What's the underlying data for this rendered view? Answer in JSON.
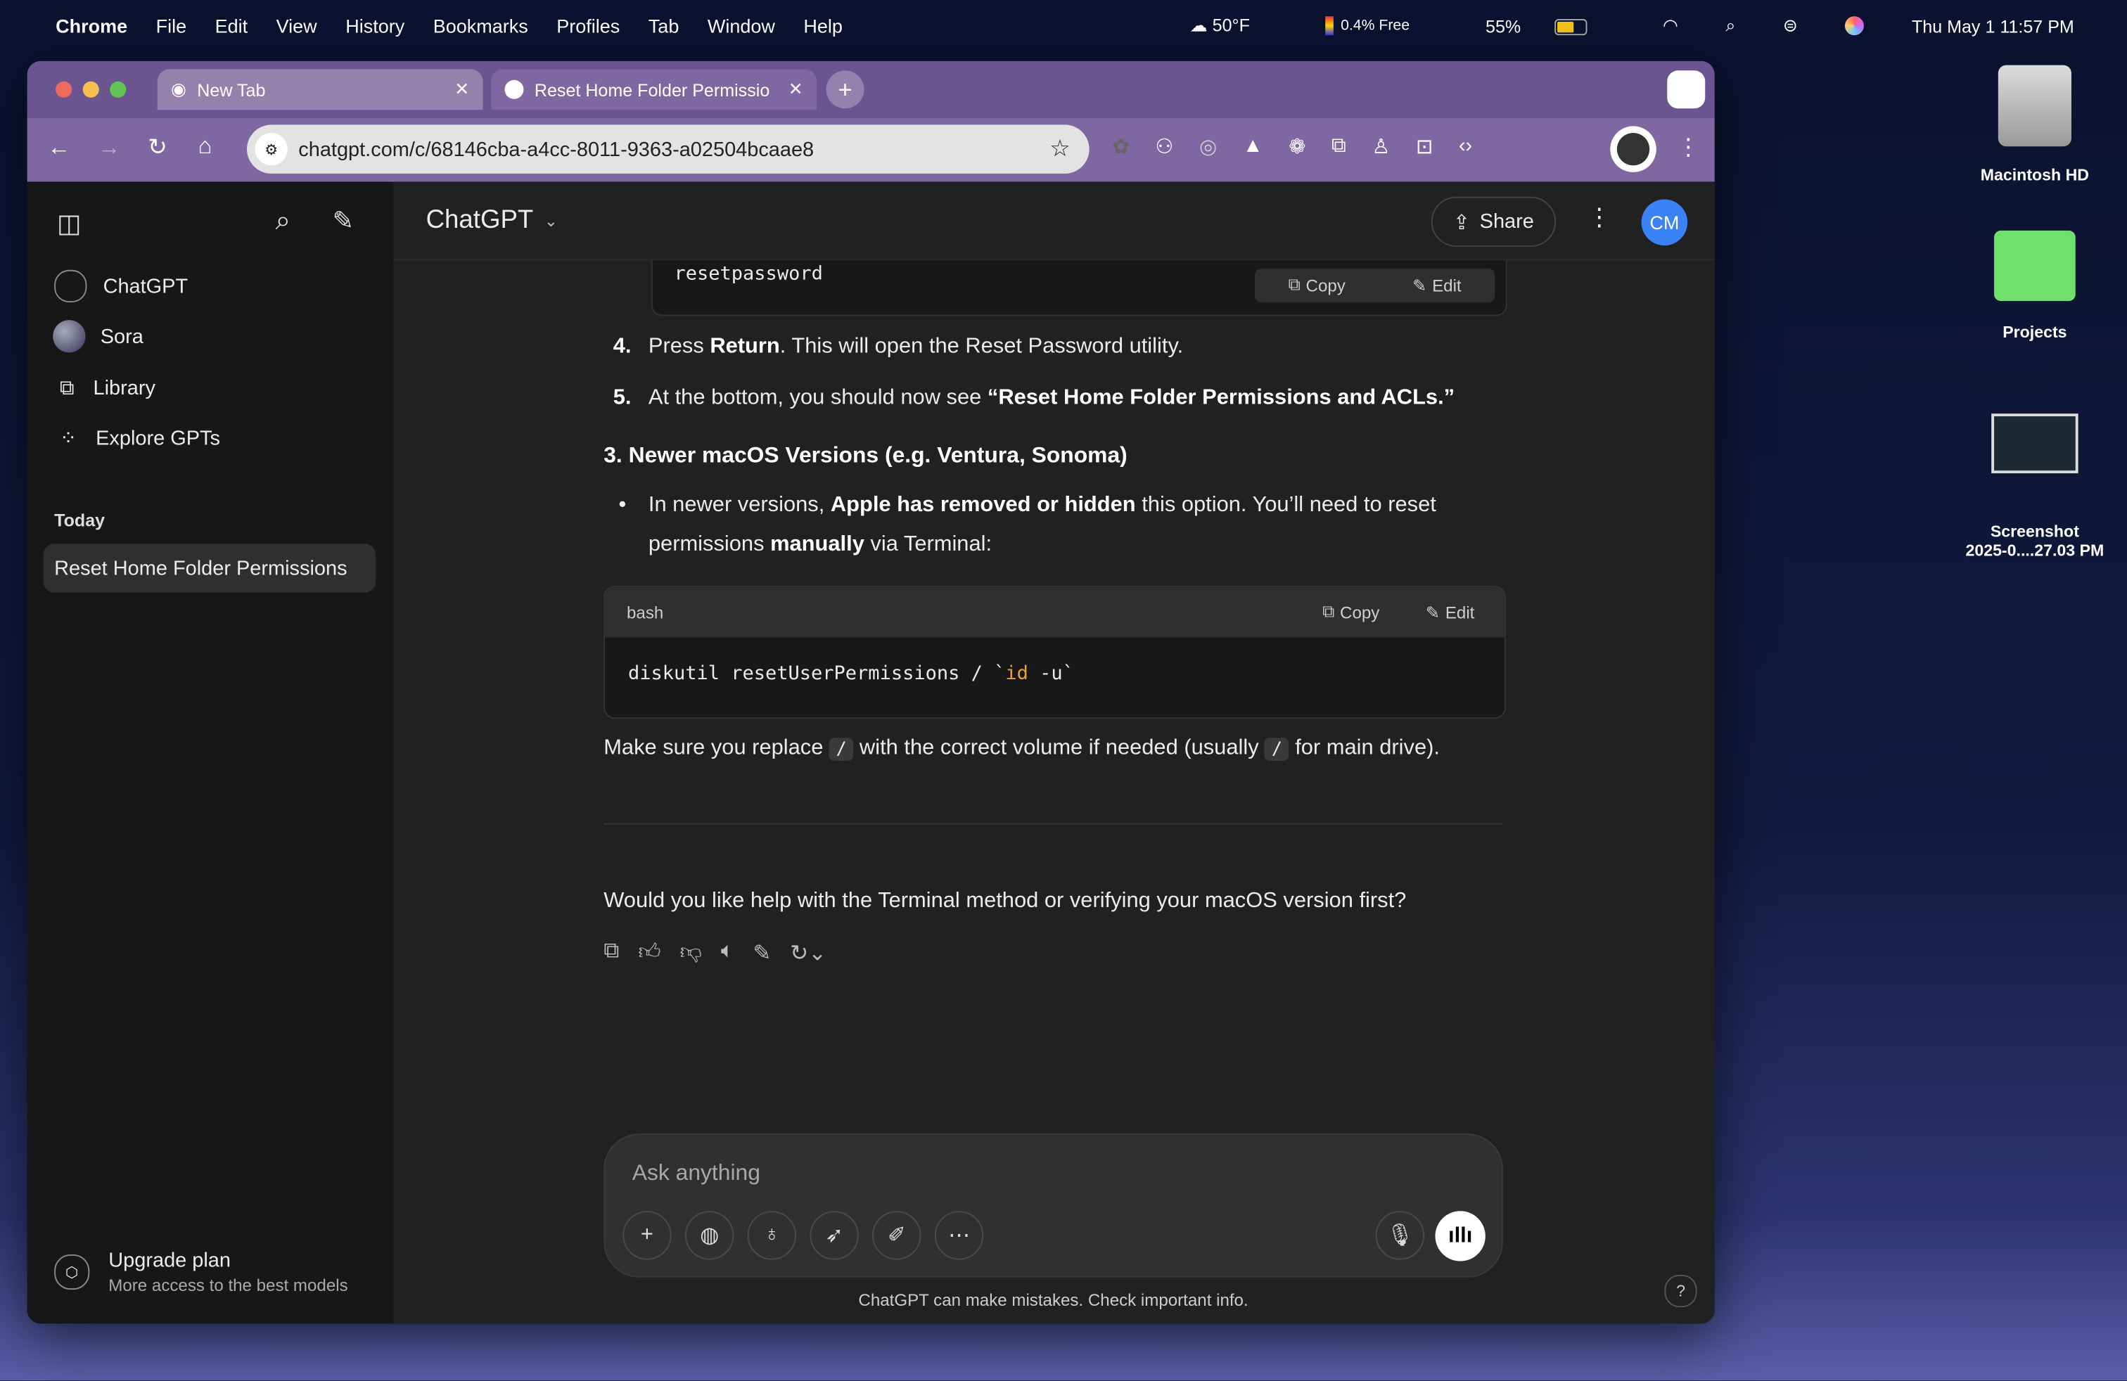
{
  "menubar": {
    "app": "Chrome",
    "items": [
      "File",
      "Edit",
      "View",
      "History",
      "Bookmarks",
      "Profiles",
      "Tab",
      "Window",
      "Help"
    ],
    "weather": "50°F",
    "memory": "0.4% Free",
    "battery": "55%",
    "battery_level": 0.55,
    "datetime": "Thu May 1  11:57 PM"
  },
  "browser": {
    "tabs": [
      {
        "title": "New Tab"
      },
      {
        "title": "Reset Home Folder Permissio"
      }
    ],
    "url": "chatgpt.com/c/68146cba-a4cc-8011-9363-a02504bcaae8"
  },
  "sidebar": {
    "nav": [
      {
        "label": "ChatGPT",
        "icon": "openai-icon"
      },
      {
        "label": "Sora",
        "icon": "sora-icon"
      },
      {
        "label": "Library",
        "icon": "library-icon"
      },
      {
        "label": "Explore GPTs",
        "icon": "grid-icon"
      }
    ],
    "section": "Today",
    "chats": [
      "Reset Home Folder Permissions"
    ],
    "upgrade": {
      "title": "Upgrade plan",
      "subtitle": "More access to the best models"
    }
  },
  "header": {
    "model": "ChatGPT",
    "share": "Share",
    "avatar": "CM",
    "avatar_color": "#3b82f6"
  },
  "conversation": {
    "code1": {
      "text": "resetpassword",
      "copy": "Copy",
      "edit": "Edit"
    },
    "step4": {
      "num": "4.",
      "pre": "Press ",
      "bold": "Return",
      "post": ". This will open the Reset Password utility."
    },
    "step5": {
      "num": "5.",
      "pre": "At the bottom, you should now see ",
      "bold": "“Reset Home Folder Permissions and ACLs.”"
    },
    "heading": "3. Newer macOS Versions (e.g. Ventura, Sonoma)",
    "bullet": {
      "t1": "In newer versions, ",
      "b1": "Apple has removed or hidden",
      "t2": " this option. You’ll need to reset permissions ",
      "b2": "manually",
      "t3": " via Terminal:"
    },
    "code2": {
      "lang": "bash",
      "copy": "Copy",
      "edit": "Edit",
      "cmd": "diskutil resetUserPermissions / `",
      "kw": "id",
      "rest": " -u`"
    },
    "note": {
      "t1": "Make sure you replace ",
      "c1": "/",
      "t2": " with the correct volume if needed (usually ",
      "c2": "/",
      "t3": " for main drive)."
    },
    "question": "Would you like help with the Terminal method or verifying your macOS version first?"
  },
  "composer": {
    "placeholder": "Ask anything",
    "disclaimer": "ChatGPT can make mistakes. Check important info.",
    "help": "?"
  },
  "desktop": [
    {
      "label": "Macintosh HD"
    },
    {
      "label": "Projects"
    },
    {
      "label": "Screenshot\n2025-0....27.03 PM"
    }
  ]
}
